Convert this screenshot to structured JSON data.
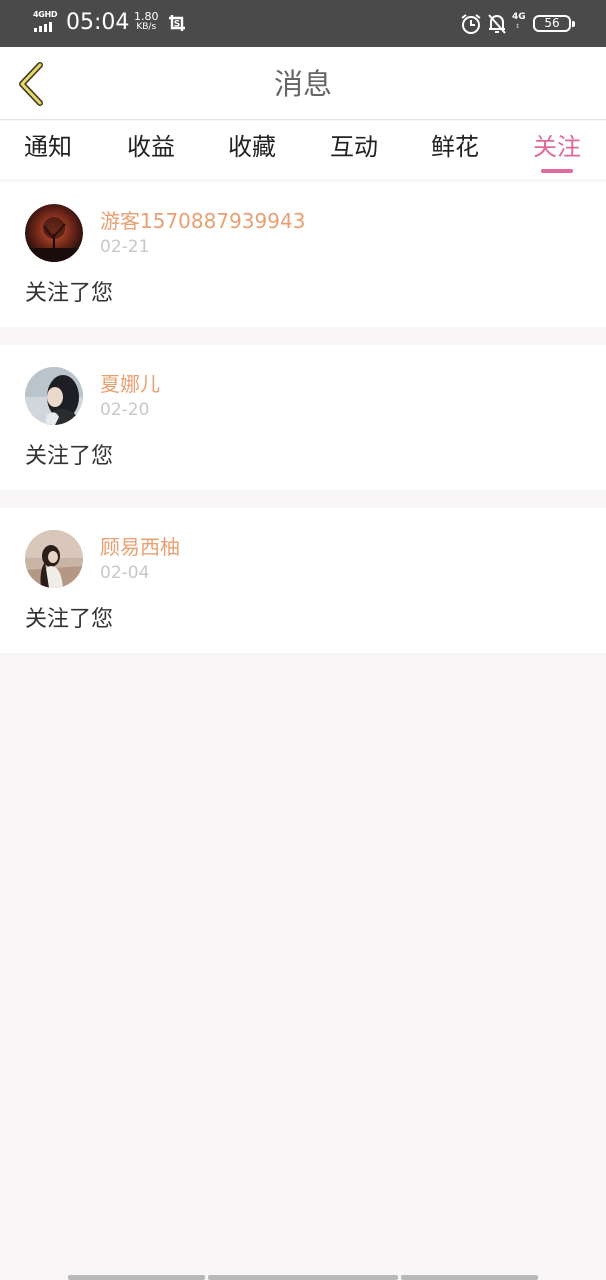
{
  "status_bar": {
    "network": "4GHD",
    "time": "05:04",
    "speed_value": "1.80",
    "speed_unit": "KB/s",
    "network2": "4G",
    "battery": "56"
  },
  "header": {
    "title": "消息"
  },
  "tabs": [
    {
      "label": "通知"
    },
    {
      "label": "收益"
    },
    {
      "label": "收藏"
    },
    {
      "label": "互动"
    },
    {
      "label": "鲜花"
    },
    {
      "label": "关注"
    }
  ],
  "active_tab": "关注",
  "messages": [
    {
      "username": "游客1570887939943",
      "date": "02-21",
      "text": "关注了您"
    },
    {
      "username": "夏娜儿",
      "date": "02-20",
      "text": "关注了您"
    },
    {
      "username": "顾易西柚",
      "date": "02-04",
      "text": "关注了您"
    }
  ],
  "colors": {
    "accent": "#e0689a",
    "username": "#e8a073",
    "date": "#c8c8c8",
    "background": "#f8f6f7"
  }
}
